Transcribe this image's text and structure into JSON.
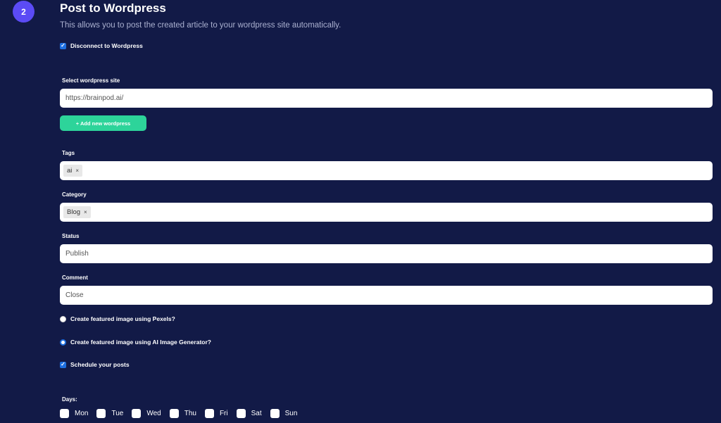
{
  "step": {
    "number": "2"
  },
  "header": {
    "title": "Post to Wordpress",
    "subtitle": "This allows you to post the created article to your wordpress site automatically."
  },
  "disconnect": {
    "label": "Disconnect to Wordpress",
    "checked": true
  },
  "site": {
    "label": "Select wordpress site",
    "value": "https://brainpod.ai/",
    "add_button": "+ Add new wordpress"
  },
  "tags": {
    "label": "Tags",
    "items": [
      "ai"
    ]
  },
  "category": {
    "label": "Category",
    "items": [
      "Blog"
    ]
  },
  "status": {
    "label": "Status",
    "value": "Publish"
  },
  "comment": {
    "label": "Comment",
    "value": "Close"
  },
  "image_options": [
    {
      "label": "Create featured image using Pexels?",
      "selected": false
    },
    {
      "label": "Create featured image using AI Image Generator?",
      "selected": true
    }
  ],
  "schedule": {
    "label": "Schedule your posts",
    "checked": true
  },
  "days": {
    "label": "Days:",
    "items": [
      "Mon",
      "Tue",
      "Wed",
      "Thu",
      "Fri",
      "Sat",
      "Sun"
    ]
  },
  "colors": {
    "background": "#121a47",
    "accent": "#5b4bf5",
    "button_green": "#2dd49a",
    "check_blue": "#1e6fe0"
  }
}
